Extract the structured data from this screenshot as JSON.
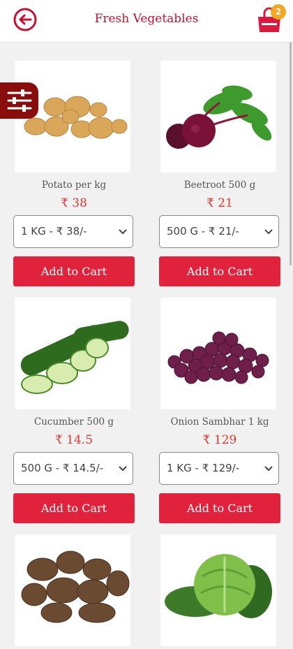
{
  "header": {
    "title": "Fresh Vegetables",
    "cart_count": "2"
  },
  "products": [
    {
      "name": "Potato per kg",
      "price": "₹ 38",
      "option": "1 KG - ₹ 38/-",
      "button": "Add to Cart",
      "image": "potato-image"
    },
    {
      "name": "Beetroot 500 g",
      "price": "₹ 21",
      "option": "500 G - ₹ 21/-",
      "button": "Add to Cart",
      "image": "beetroot-image"
    },
    {
      "name": "Cucumber 500 g",
      "price": "₹ 14.5",
      "option": "500 G - ₹ 14.5/-",
      "button": "Add to Cart",
      "image": "cucumber-image"
    },
    {
      "name": "Onion Sambhar 1 kg",
      "price": "₹ 129",
      "option": "1 KG - ₹ 129/-",
      "button": "Add to Cart",
      "image": "onion-image"
    },
    {
      "image": "yam-image"
    },
    {
      "image": "cabbage-image"
    }
  ],
  "colors": {
    "brand": "#c8102e",
    "button": "#e0223d",
    "price": "#e4352f",
    "badge": "#f5a623"
  }
}
